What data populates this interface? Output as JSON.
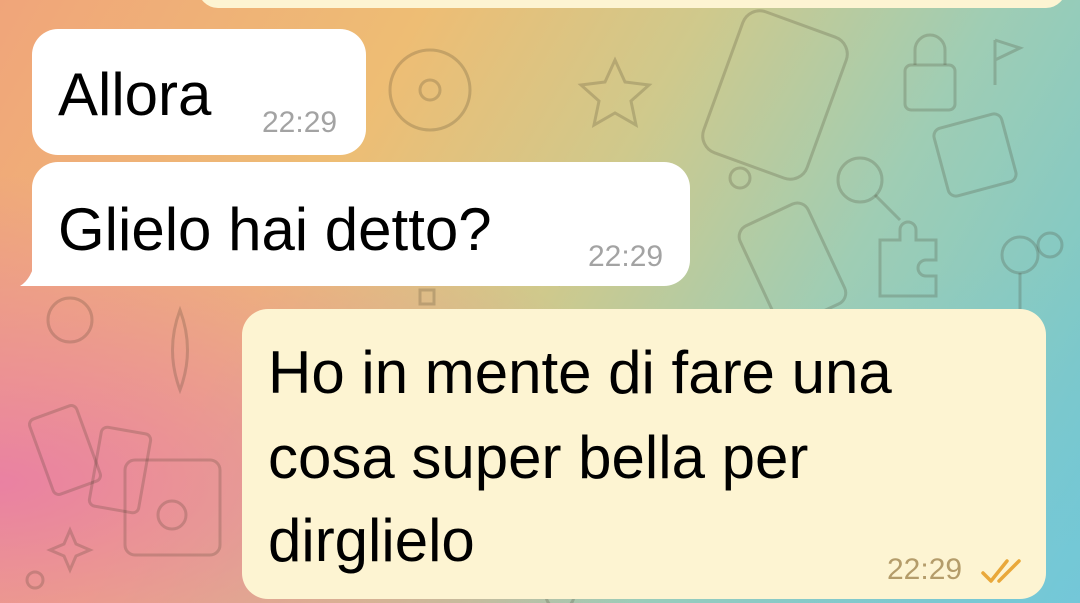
{
  "chat": {
    "messages": [
      {
        "direction": "incoming",
        "text": "Allora",
        "time": "22:29"
      },
      {
        "direction": "incoming",
        "text": "Glielo hai detto?",
        "time": "22:29"
      },
      {
        "direction": "outgoing",
        "lines": [
          "Ho in mente di fare una",
          "cosa super bella per",
          "dirglielo"
        ],
        "time": "22:29",
        "status": "read-double-check-icon"
      }
    ]
  },
  "theme": {
    "incoming_bubble": "#ffffff",
    "outgoing_bubble": "#fdf4d2",
    "read_tick_color": "#e9a83a",
    "time_color": "#a3a3a3"
  }
}
